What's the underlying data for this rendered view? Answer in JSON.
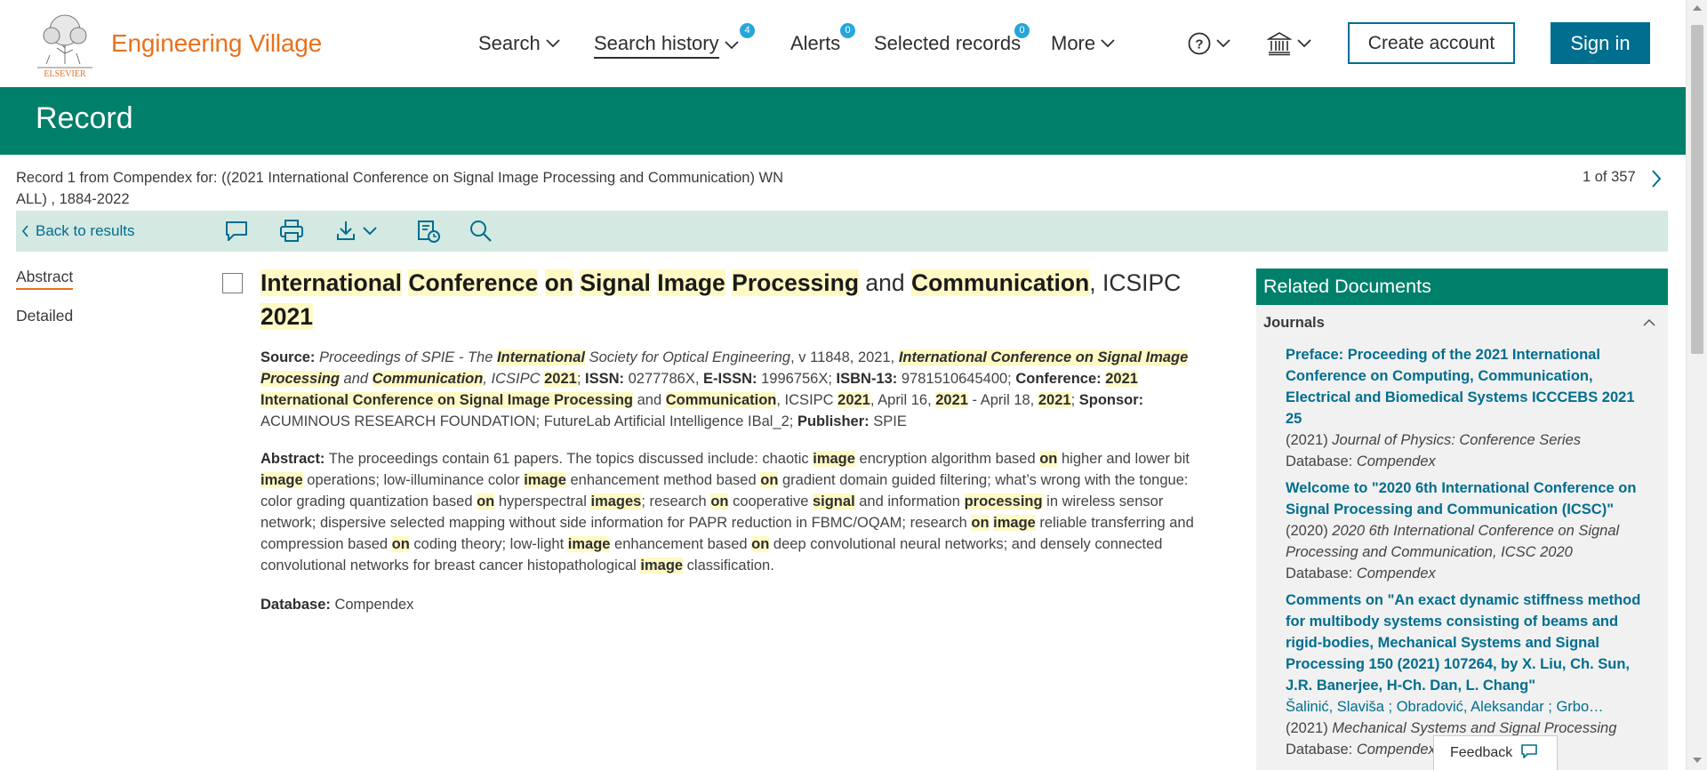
{
  "header": {
    "logo_text": "Engineering Village",
    "logo_mark": "ELSEVIER",
    "nav": {
      "search": "Search",
      "search_history": "Search history",
      "search_history_badge": "4",
      "alerts": "Alerts",
      "alerts_badge": "0",
      "selected_records": "Selected records",
      "selected_badge": "0",
      "more": "More"
    },
    "create_account": "Create account",
    "sign_in": "Sign in"
  },
  "banner": {
    "title": "Record"
  },
  "record_info": {
    "line1": "Record 1 from Compendex for: ((2021 International Conference on Signal Image Processing and Communication) WN",
    "line2": "ALL) , 1884-2022",
    "pager": "1 of 357"
  },
  "toolbar": {
    "back": "Back to results",
    "icons": [
      "comment-icon",
      "print-icon",
      "download-icon",
      "cite-icon",
      "search-icon"
    ]
  },
  "left_tabs": {
    "abstract": "Abstract",
    "detailed": "Detailed"
  },
  "record": {
    "title_parts": [
      {
        "t": "International",
        "h": true
      },
      {
        "t": " ",
        "h": false
      },
      {
        "t": "Conference",
        "h": true
      },
      {
        "t": " ",
        "h": false
      },
      {
        "t": "on",
        "h": true
      },
      {
        "t": " ",
        "h": false
      },
      {
        "t": "Signal",
        "h": true
      },
      {
        "t": " ",
        "h": false
      },
      {
        "t": "Image",
        "h": true
      },
      {
        "t": " ",
        "h": false
      },
      {
        "t": "Processing",
        "h": true
      },
      {
        "t": " and ",
        "h": false
      },
      {
        "t": "Communication",
        "h": true
      },
      {
        "t": ", ICSIPC ",
        "h": false
      },
      {
        "t": "2021",
        "h": true
      }
    ],
    "source_label": "Source:",
    "source_parts": [
      {
        "t": " ",
        "s": ""
      },
      {
        "t": "Proceedings of SPIE - The ",
        "s": "i"
      },
      {
        "t": "International",
        "s": "ihb"
      },
      {
        "t": " Society for Optical Engineering",
        "s": "i"
      },
      {
        "t": ", v 11848, 2021, ",
        "s": ""
      },
      {
        "t": "International Conference on Signal Image Processing",
        "s": "ihb"
      },
      {
        "t": " and ",
        "s": "i"
      },
      {
        "t": "Communication",
        "s": "ihb"
      },
      {
        "t": ", ICSIPC ",
        "s": "i"
      },
      {
        "t": "2021",
        "s": "hb"
      },
      {
        "t": "; ",
        "s": ""
      },
      {
        "t": " ISSN:",
        "s": "b"
      },
      {
        "t": " 0277786X, ",
        "s": ""
      },
      {
        "t": " E-ISSN:",
        "s": "b"
      },
      {
        "t": " 1996756X; ",
        "s": ""
      },
      {
        "t": " ISBN-13:",
        "s": "b"
      },
      {
        "t": " 9781510645400; ",
        "s": ""
      },
      {
        "t": "Conference:",
        "s": "b"
      },
      {
        "t": " ",
        "s": ""
      },
      {
        "t": "2021 International Conference on Signal Image Processing",
        "s": "hb"
      },
      {
        "t": " and ",
        "s": ""
      },
      {
        "t": "Communication",
        "s": "hb"
      },
      {
        "t": ", ICSIPC ",
        "s": ""
      },
      {
        "t": "2021",
        "s": "hb"
      },
      {
        "t": ", April 16, ",
        "s": ""
      },
      {
        "t": "2021",
        "s": "hb"
      },
      {
        "t": " - April 18, ",
        "s": ""
      },
      {
        "t": "2021",
        "s": "hb"
      },
      {
        "t": "; ",
        "s": ""
      },
      {
        "t": "Sponsor:",
        "s": "b"
      },
      {
        "t": " ACUMINOUS RESEARCH FOUNDATION; FutureLab Artificial Intelligence IBal_2; ",
        "s": ""
      },
      {
        "t": "Publisher:",
        "s": "b"
      },
      {
        "t": " SPIE",
        "s": ""
      }
    ],
    "abstract_label": "Abstract:",
    "abstract_parts": [
      {
        "t": " The proceedings contain 61 papers. The topics discussed include: chaotic ",
        "h": false
      },
      {
        "t": "image",
        "h": true
      },
      {
        "t": " encryption algorithm based ",
        "h": false
      },
      {
        "t": "on",
        "h": true
      },
      {
        "t": " higher and lower bit ",
        "h": false
      },
      {
        "t": "image",
        "h": true
      },
      {
        "t": " operations; low-illuminance color ",
        "h": false
      },
      {
        "t": "image",
        "h": true
      },
      {
        "t": " enhancement method based ",
        "h": false
      },
      {
        "t": "on",
        "h": true
      },
      {
        "t": " gradient domain guided filtering; what’s wrong with the tongue: color grading quantization based ",
        "h": false
      },
      {
        "t": "on",
        "h": true
      },
      {
        "t": " hyperspectral ",
        "h": false
      },
      {
        "t": "images",
        "h": true
      },
      {
        "t": "; research ",
        "h": false
      },
      {
        "t": "on",
        "h": true
      },
      {
        "t": " cooperative ",
        "h": false
      },
      {
        "t": "signal",
        "h": true
      },
      {
        "t": " and information ",
        "h": false
      },
      {
        "t": "processing",
        "h": true
      },
      {
        "t": " in wireless sensor network; dispersive selected mapping without side information for PAPR reduction in FBMC/OQAM; research ",
        "h": false
      },
      {
        "t": "on",
        "h": true
      },
      {
        "t": " ",
        "h": false
      },
      {
        "t": "image",
        "h": true
      },
      {
        "t": " reliable transferring and compression based ",
        "h": false
      },
      {
        "t": "on",
        "h": true
      },
      {
        "t": " coding theory; low-light ",
        "h": false
      },
      {
        "t": "image",
        "h": true
      },
      {
        "t": " enhancement based ",
        "h": false
      },
      {
        "t": "on",
        "h": true
      },
      {
        "t": " deep convolutional neural networks; and densely connected convolutional networks for breast cancer histopathological ",
        "h": false
      },
      {
        "t": "image",
        "h": true
      },
      {
        "t": " classification.",
        "h": false
      }
    ],
    "database_label": "Database:",
    "database": " Compendex"
  },
  "related": {
    "title": "Related Documents",
    "section": "Journals",
    "items": [
      {
        "title": "Preface: Proceeding of the 2021 International Conference on Computing, Communication, Electrical and Biomedical Systems ICCCEBS 2021 25",
        "year": "(2021)",
        "source": "Journal of Physics: Conference Series",
        "db_label": "Database:",
        "db": "Compendex"
      },
      {
        "title": "Welcome to \"2020 6th International Conference on Signal Processing and Communication (ICSC)\"",
        "year": "(2020)",
        "source": "2020 6th International Conference on Signal Processing and Communication, ICSC 2020",
        "db_label": "Database:",
        "db": "Compendex"
      },
      {
        "title": "Comments on \"An exact dynamic stiffness method for multibody systems consisting of beams and rigid-bodies, Mechanical Systems and Signal Processing 150 (2021) 107264, by X. Liu, Ch. Sun, J.R. Banerjee, H-Ch. Dan, L. Chang\"",
        "authors": "Šalinić, Slaviša ; Obradović, Aleksandar ; Grbo…",
        "year": "(2021)",
        "source": "Mechanical Systems and Signal Processing",
        "db_label": "Database:",
        "db": "Compendex"
      }
    ]
  },
  "feedback": "Feedback",
  "colors": {
    "brand_orange": "#e9711c",
    "teal_banner": "#007f6a",
    "link_blue": "#006e8f",
    "highlight": "#fff9c4",
    "badge": "#26a6da"
  }
}
